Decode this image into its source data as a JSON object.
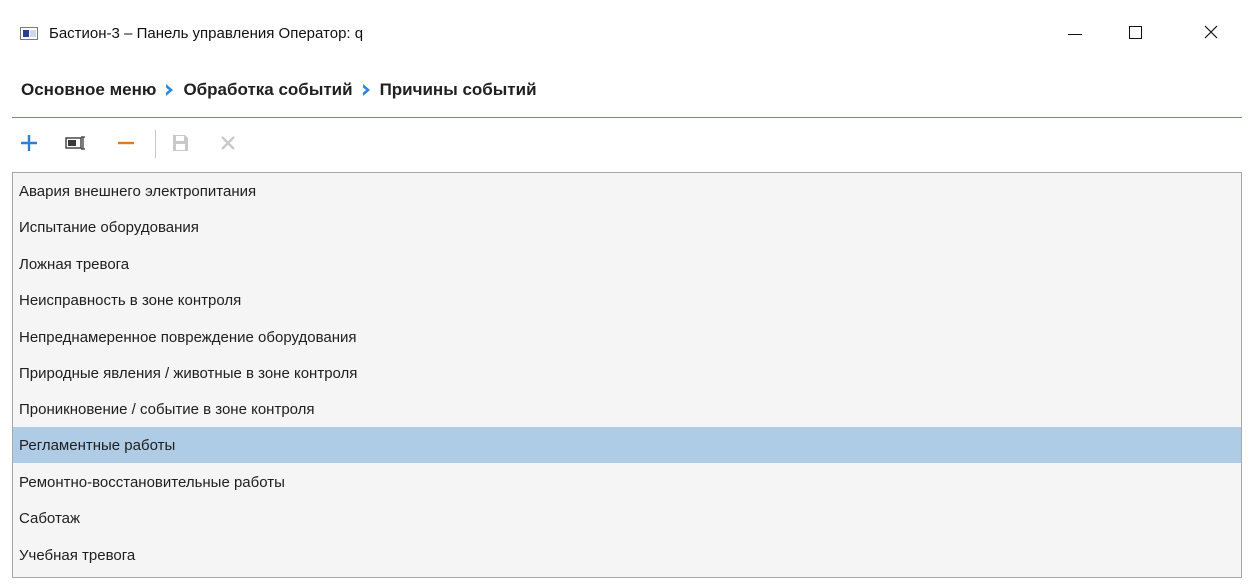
{
  "window": {
    "title": "Бастион-3 – Панель управления Оператор: q",
    "app_icon": "window-app-icon",
    "controls": [
      "minimize-icon",
      "maximize-icon",
      "close-icon"
    ]
  },
  "breadcrumb": {
    "items": [
      "Основное меню",
      "Обработка событий",
      "Причины событий"
    ],
    "separator_icon": "chevron-right-icon",
    "separator_color": "#2e86d6"
  },
  "toolbar": {
    "buttons": [
      {
        "icon": "add-icon",
        "color": "#2f7fd6",
        "enabled": true
      },
      {
        "icon": "rename-icon",
        "color": "#3a3a3a",
        "enabled": true
      },
      {
        "icon": "remove-icon",
        "color": "#e07a20",
        "enabled": true
      },
      {
        "icon": "save-icon",
        "color": "#c9c9c9",
        "enabled": false
      },
      {
        "icon": "delete-icon",
        "color": "#c9c9c9",
        "enabled": false
      }
    ]
  },
  "list": {
    "items": [
      "Авария внешнего электропитания",
      "Испытание оборудования",
      "Ложная тревога",
      "Неисправность в зоне контроля",
      "Непреднамеренное повреждение оборудования",
      "Природные явления / животные в зоне контроля",
      "Проникновение / событие в зоне контроля",
      "Регламентные работы",
      "Ремонтно-восстановительные работы",
      "Саботаж",
      "Учебная тревога"
    ],
    "selected_item": "Регламентные работы",
    "selection_color": "#afcce6"
  },
  "colors": {
    "accent_line": "#5b8fd0",
    "list_background": "#f5f5f5"
  }
}
